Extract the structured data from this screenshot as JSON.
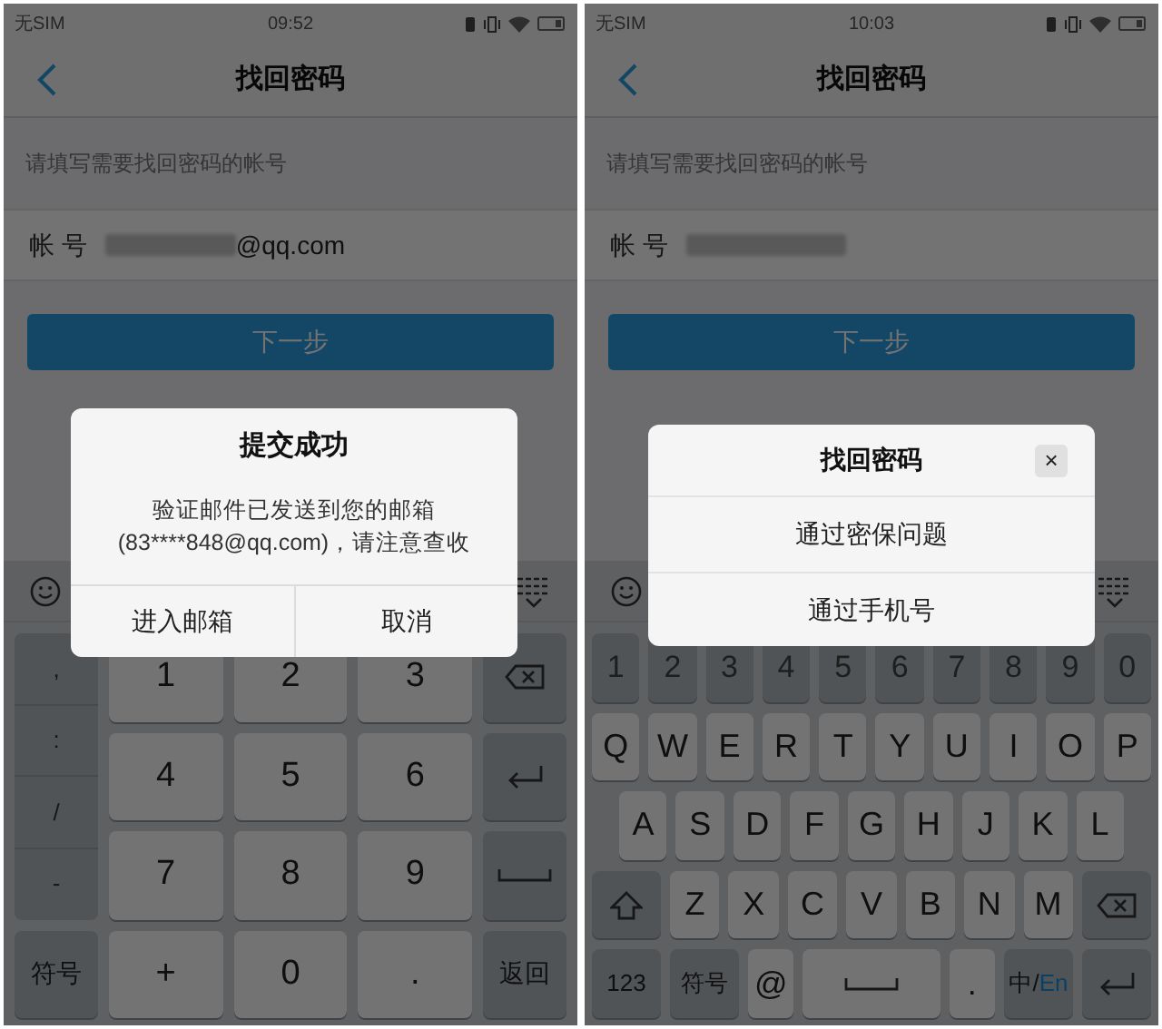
{
  "screens": [
    {
      "status_bar": {
        "carrier": "无SIM",
        "time": "09:52"
      },
      "nav": {
        "title": "找回密码"
      },
      "hint": "请填写需要找回密码的帐号",
      "account": {
        "label": "帐 号",
        "redacted": true,
        "value": "@qq.com"
      },
      "next_button": "下一步",
      "keyboard": {
        "kind": "numeric",
        "side_list": [
          ",",
          ":",
          "/",
          "-"
        ],
        "rows": [
          {
            "keys": [
              {
                "kind": "key",
                "label": "1"
              },
              {
                "kind": "key",
                "label": "2"
              },
              {
                "kind": "key",
                "label": "3"
              },
              {
                "kind": "backspace"
              }
            ]
          },
          {
            "keys": [
              {
                "kind": "key",
                "label": "4"
              },
              {
                "kind": "key",
                "label": "5"
              },
              {
                "kind": "key",
                "label": "6"
              },
              {
                "kind": "enter"
              }
            ]
          },
          {
            "keys": [
              {
                "kind": "key",
                "label": "7"
              },
              {
                "kind": "key",
                "label": "8"
              },
              {
                "kind": "key",
                "label": "9"
              },
              {
                "kind": "space"
              }
            ]
          },
          {
            "keys": [
              {
                "kind": "function_key",
                "label": "符号"
              },
              {
                "kind": "key",
                "label": "+"
              },
              {
                "kind": "key",
                "label": "0"
              },
              {
                "kind": "key",
                "label": "."
              },
              {
                "kind": "function_key",
                "label": "返回"
              }
            ]
          }
        ]
      },
      "dialog": {
        "kind": "alert",
        "title": "提交成功",
        "message_lines": [
          "验证邮件已发送到您的邮箱",
          "(83****848@qq.com)，请注意查收"
        ],
        "buttons": [
          "进入邮箱",
          "取消"
        ]
      }
    },
    {
      "status_bar": {
        "carrier": "无SIM",
        "time": "10:03"
      },
      "nav": {
        "title": "找回密码"
      },
      "hint": "请填写需要找回密码的帐号",
      "account": {
        "label": "帐 号",
        "redacted": true
      },
      "next_button": "下一步",
      "keyboard": {
        "kind": "qwerty",
        "rows": [
          {
            "keys": [
              {
                "kind": "function_key",
                "label": "1"
              },
              {
                "kind": "function_key",
                "label": "2"
              },
              {
                "kind": "function_key",
                "label": "3"
              },
              {
                "kind": "function_key",
                "label": "4"
              },
              {
                "kind": "function_key",
                "label": "5"
              },
              {
                "kind": "function_key",
                "label": "6"
              },
              {
                "kind": "function_key",
                "label": "7"
              },
              {
                "kind": "function_key",
                "label": "8"
              },
              {
                "kind": "function_key",
                "label": "9"
              },
              {
                "kind": "function_key",
                "label": "0"
              }
            ]
          },
          {
            "keys": [
              {
                "kind": "key",
                "label": "Q"
              },
              {
                "kind": "key",
                "label": "W"
              },
              {
                "kind": "key",
                "label": "E"
              },
              {
                "kind": "key",
                "label": "R"
              },
              {
                "kind": "key",
                "label": "T"
              },
              {
                "kind": "key",
                "label": "Y"
              },
              {
                "kind": "key",
                "label": "U"
              },
              {
                "kind": "key",
                "label": "I"
              },
              {
                "kind": "key",
                "label": "O"
              },
              {
                "kind": "key",
                "label": "P"
              }
            ]
          },
          {
            "keys": [
              {
                "kind": "key",
                "label": "A"
              },
              {
                "kind": "key",
                "label": "S"
              },
              {
                "kind": "key",
                "label": "D"
              },
              {
                "kind": "key",
                "label": "F"
              },
              {
                "kind": "key",
                "label": "G"
              },
              {
                "kind": "key",
                "label": "H"
              },
              {
                "kind": "key",
                "label": "J"
              },
              {
                "kind": "key",
                "label": "K"
              },
              {
                "kind": "key",
                "label": "L"
              }
            ]
          },
          {
            "keys": [
              {
                "kind": "shift"
              },
              {
                "kind": "key",
                "label": "Z"
              },
              {
                "kind": "key",
                "label": "X"
              },
              {
                "kind": "key",
                "label": "C"
              },
              {
                "kind": "key",
                "label": "V"
              },
              {
                "kind": "key",
                "label": "B"
              },
              {
                "kind": "key",
                "label": "N"
              },
              {
                "kind": "key",
                "label": "M"
              },
              {
                "kind": "backspace"
              }
            ]
          },
          {
            "keys": [
              {
                "kind": "function_key",
                "label": "123"
              },
              {
                "kind": "function_key",
                "label": "符号"
              },
              {
                "kind": "key",
                "label": "@"
              },
              {
                "kind": "space"
              },
              {
                "kind": "key",
                "label": "."
              },
              {
                "kind": "function_key",
                "label_parts": [
                  {
                    "text": "中/",
                    "selected": false
                  },
                  {
                    "text": "En",
                    "selected": true
                  }
                ]
              },
              {
                "kind": "enter"
              }
            ]
          }
        ]
      },
      "dialog": {
        "kind": "menu",
        "title": "找回密码",
        "close": "×",
        "options": [
          "通过密保问题",
          "通过手机号"
        ]
      }
    }
  ]
}
